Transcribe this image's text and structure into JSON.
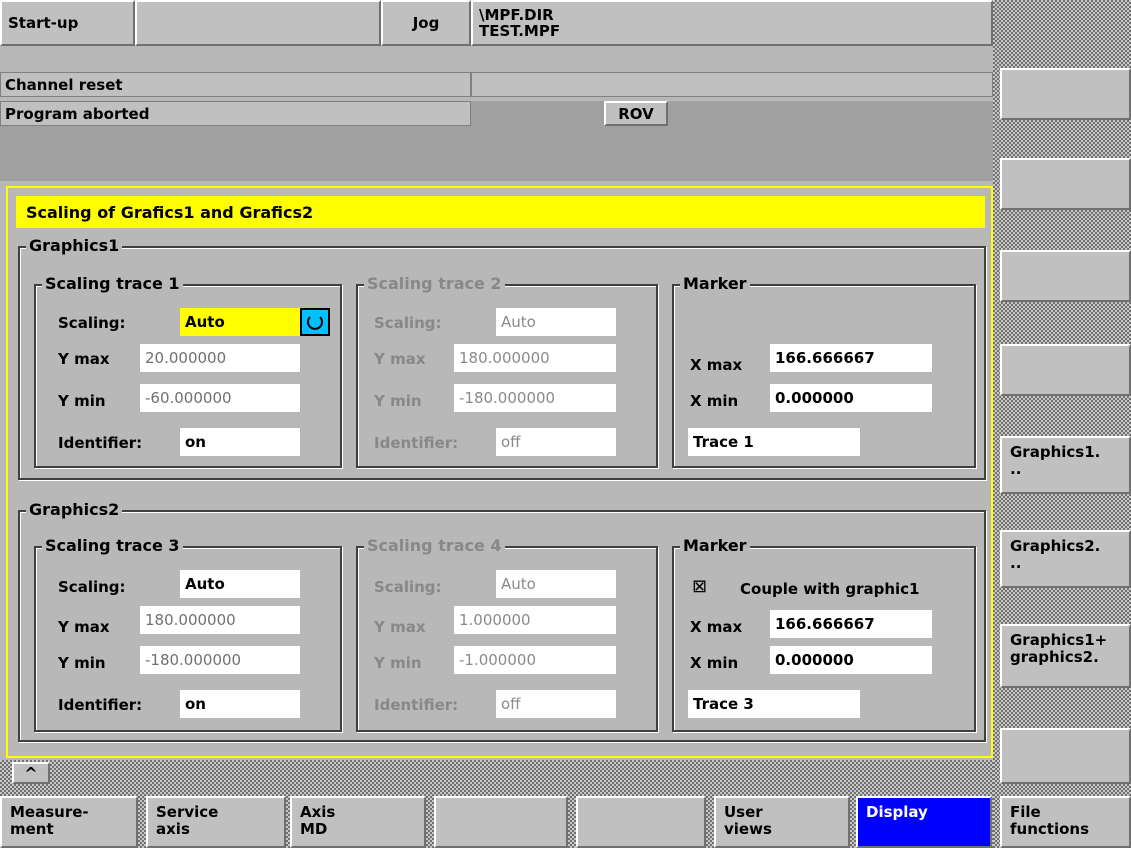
{
  "header": {
    "area": "Start-up",
    "blank1": "",
    "mode": "Jog",
    "path_line1": "\\MPF.DIR",
    "path_line2": "TEST.MPF",
    "channel_status": "Channel reset",
    "program_status": "Program aborted",
    "rov": "ROV"
  },
  "dialog": {
    "title": "Scaling of Grafics1 and Grafics2",
    "graphics1": {
      "title": "Graphics1",
      "trace1": {
        "title": "Scaling trace 1",
        "scaling_label": "Scaling:",
        "scaling_value": "Auto",
        "ymax_label": "Y max",
        "ymax_value": "20.000000",
        "ymin_label": "Y min",
        "ymin_value": "-60.000000",
        "identifier_label": "Identifier:",
        "identifier_value": "on"
      },
      "trace2": {
        "title": "Scaling trace 2",
        "scaling_label": "Scaling:",
        "scaling_value": "Auto",
        "ymax_label": "Y max",
        "ymax_value": "180.000000",
        "ymin_label": "Y min",
        "ymin_value": "-180.000000",
        "identifier_label": "Identifier:",
        "identifier_value": "off"
      },
      "marker": {
        "title": "Marker",
        "xmax_label": "X max",
        "xmax_value": "166.666667",
        "xmin_label": "X min",
        "xmin_value": "0.000000",
        "trace_value": "Trace 1"
      }
    },
    "graphics2": {
      "title": "Graphics2",
      "trace3": {
        "title": "Scaling trace 3",
        "scaling_label": "Scaling:",
        "scaling_value": "Auto",
        "ymax_label": "Y max",
        "ymax_value": "180.000000",
        "ymin_label": "Y min",
        "ymin_value": "-180.000000",
        "identifier_label": "Identifier:",
        "identifier_value": "on"
      },
      "trace4": {
        "title": "Scaling trace 4",
        "scaling_label": "Scaling:",
        "scaling_value": "Auto",
        "ymax_label": "Y max",
        "ymax_value": "1.000000",
        "ymin_label": "Y min",
        "ymin_value": "-1.000000",
        "identifier_label": "Identifier:",
        "identifier_value": "off"
      },
      "marker": {
        "title": "Marker",
        "couple_checkbox": "⊠",
        "couple_label": "Couple with graphic1",
        "xmax_label": "X max",
        "xmax_value": "166.666667",
        "xmin_label": "X min",
        "xmin_value": "0.000000",
        "trace_value": "Trace 3"
      }
    }
  },
  "recall": "^",
  "vertical_softkeys": {
    "graphics1": "Graphics1.\n..",
    "graphics2": "Graphics2.\n..",
    "both": "Graphics1+\ngraphics2."
  },
  "horizontal_softkeys": {
    "measurement": "Measure-\nment",
    "service_axis": "Service\naxis",
    "axis_md": "Axis\nMD",
    "user_views": "User\nviews",
    "display": "Display",
    "file_functions": "File\nfunctions"
  },
  "colors": {
    "active_softkey": "#0000ff",
    "highlight": "#ffff00",
    "background": "#c0c0c0"
  }
}
